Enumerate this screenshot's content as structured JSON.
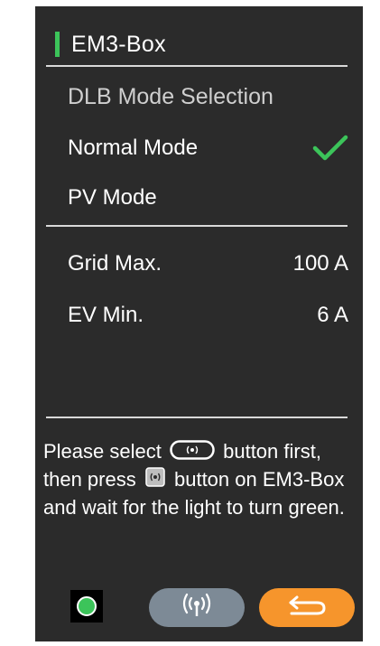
{
  "header": {
    "title": "EM3-Box",
    "accent_color": "#3cc45a"
  },
  "dlb": {
    "heading": "DLB Mode Selection",
    "modes": [
      {
        "label": "Normal Mode",
        "selected": true
      },
      {
        "label": "PV  Mode",
        "selected": false
      }
    ]
  },
  "settings": [
    {
      "label": "Grid Max.",
      "value": "100 A"
    },
    {
      "label": "EV Min.",
      "value": "6 A"
    }
  ],
  "hint": {
    "part1": "Please select",
    "part2": "button first, then press",
    "part3": "button on EM3-Box and wait for the light to turn green."
  },
  "footer": {
    "status_color": "#3cc45a",
    "wireless_icon": "wireless-signal-icon",
    "back_icon": "return-arrow-icon",
    "wireless_button_color": "#7d8a96",
    "back_button_color": "#f6952c"
  }
}
